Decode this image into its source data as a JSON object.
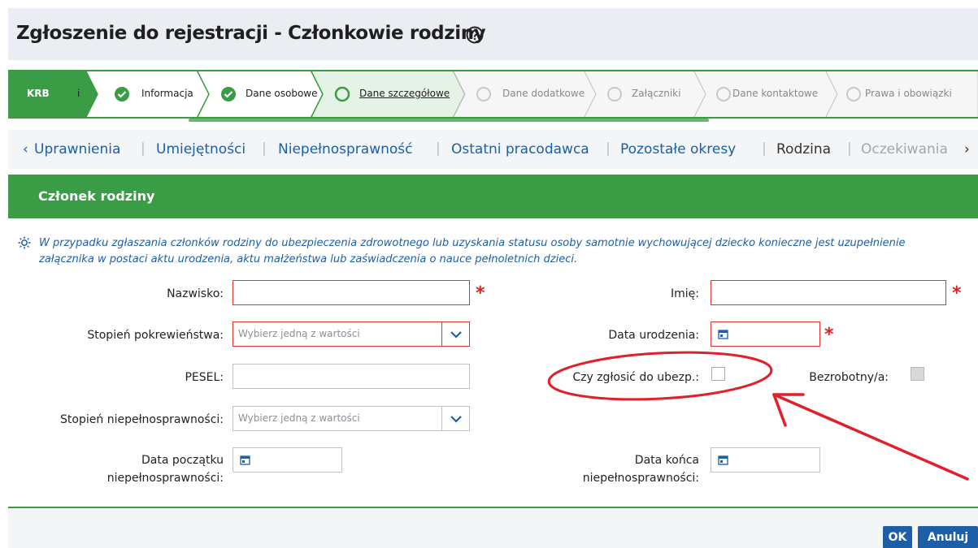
{
  "header": {
    "title": "Zgłoszenie do rejestracji - Członkowie rodziny",
    "help_icon": "question-circle-icon"
  },
  "wizard": {
    "steps": [
      {
        "label": "KRB",
        "state": "brand"
      },
      {
        "label": "i",
        "state": "done"
      },
      {
        "label": "Informacja",
        "state": "done"
      },
      {
        "label": "Dane osobowe",
        "state": "done"
      },
      {
        "label": "Dane szczegółowe",
        "state": "current"
      },
      {
        "label": "Dane dodatkowe",
        "state": "pending"
      },
      {
        "label": "Załączniki",
        "state": "pending"
      },
      {
        "label": "Dane kontaktowe",
        "state": "pending"
      },
      {
        "label": "Prawa i obowiązki",
        "state": "pending"
      }
    ]
  },
  "subnav": {
    "prev_arrow": "‹",
    "next_arrow": "›",
    "items": [
      "Uprawnienia",
      "Umiejętności",
      "Niepełnosprawność",
      "Ostatni pracodawca",
      "Pozostałe okresy",
      "Rodzina",
      "Oczekiwania"
    ],
    "separator": "|"
  },
  "section": {
    "title": "Członek rodziny",
    "info": "W przypadku zgłaszania członków rodziny do ubezpieczenia zdrowotnego lub uzyskania statusu osoby samotnie wychowującej dziecko konieczne jest uzupełnienie załącznika w postaci aktu urodzenia, aktu małżeństwa lub zaświadczenia o nauce pełnoletnich dzieci."
  },
  "form": {
    "nazwisko_label": "Nazwisko:",
    "imie_label": "Imię:",
    "pokrewienstwo_label": "Stopień pokrewieństwa:",
    "pokrewienstwo_placeholder": "Wybierz jedną z wartości",
    "data_ur_label": "Data urodzenia:",
    "pesel_label": "PESEL:",
    "ubezp_label": "Czy zgłosić do ubezp.:",
    "bezrobotny_label": "Bezrobotny/a:",
    "niepelnospr_label": "Stopień niepełnosprawności:",
    "niepelnospr_placeholder": "Wybierz jedną z wartości",
    "data_pocz_label_1": "Data początku",
    "data_pocz_label_2": "niepełnosprawności:",
    "data_konca_label_1": "Data końca",
    "data_konca_label_2": "niepełnosprawności:",
    "required_mark": "*"
  },
  "footer": {
    "ok_label": "OK",
    "cancel_label": "Anuluj"
  },
  "colors": {
    "green": "#3a9c45",
    "blue": "#1d5fa6",
    "required": "#d22",
    "annotation": "#e0202a"
  }
}
